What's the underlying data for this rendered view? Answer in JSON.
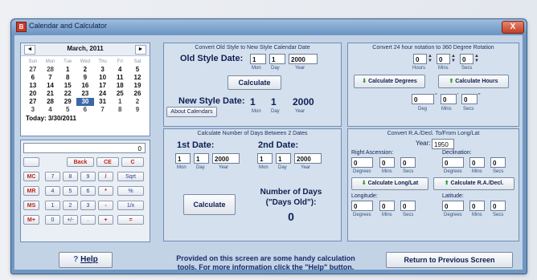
{
  "window": {
    "title": "Calendar and Calculator",
    "close_label": "X",
    "icon_label": "B"
  },
  "calendar": {
    "month_label": "March, 2011",
    "prev": "◄",
    "next": "►",
    "weekdays": [
      "Sun",
      "Mon",
      "Tue",
      "Wed",
      "Thu",
      "Fri",
      "Sat"
    ],
    "weeks": [
      [
        "27",
        "28",
        "1",
        "2",
        "3",
        "4",
        "5"
      ],
      [
        "6",
        "7",
        "8",
        "9",
        "10",
        "11",
        "12"
      ],
      [
        "13",
        "14",
        "15",
        "16",
        "17",
        "18",
        "19"
      ],
      [
        "20",
        "21",
        "22",
        "23",
        "24",
        "25",
        "26"
      ],
      [
        "27",
        "28",
        "29",
        "30",
        "31",
        "1",
        "2"
      ],
      [
        "3",
        "4",
        "5",
        "6",
        "7",
        "8",
        "9"
      ]
    ],
    "today_label": "Today: 3/30/2011"
  },
  "calculator": {
    "display": "0",
    "row1": [
      "Back",
      "CE",
      "C"
    ],
    "rows": [
      [
        "MC",
        "7",
        "8",
        "9",
        "/",
        "Sqrt"
      ],
      [
        "MR",
        "4",
        "5",
        "6",
        "*",
        "%"
      ],
      [
        "MS",
        "1",
        "2",
        "3",
        "-",
        "1/x"
      ],
      [
        "M+",
        "0",
        "+/-",
        ".",
        "+",
        "="
      ]
    ]
  },
  "old_style": {
    "title": "Convert Old Style to New Style Calendar Date",
    "label": "Old Style Date:",
    "month": "1",
    "day": "1",
    "year": "2000",
    "sub_mon": "Mon",
    "sub_day": "Day",
    "sub_year": "Year",
    "calculate": "Calculate",
    "result_label": "New Style Date:",
    "r_month": "1",
    "r_day": "1",
    "r_year": "2000",
    "about": "About Calendars"
  },
  "days_between": {
    "title": "Calculate Number of Days Between 2 Dates",
    "first_label": "1st Date:",
    "second_label": "2nd Date:",
    "d1_month": "1",
    "d1_day": "1",
    "d1_year": "2000",
    "d2_month": "1",
    "d2_day": "1",
    "d2_year": "2000",
    "sub_mon": "Mon",
    "sub_day": "Day",
    "sub_year": "Year",
    "calculate": "Calculate",
    "result_label_1": "Number of Days",
    "result_label_2": "(\"Days Old\"):",
    "result_value": "0"
  },
  "rotation": {
    "title": "Convert 24 hour notation to 360 Degree Rotation",
    "hours": "0",
    "mins": "0",
    "secs": "0",
    "sub_hours": "Hours",
    "sub_mins": "Mins",
    "sub_secs": "Secs",
    "calc_degrees": "Calculate Degrees",
    "calc_hours": "Calculate Hours",
    "deg": "0",
    "min": "0",
    "sec": "0",
    "sub_deg": "Deg",
    "sub_min": "Mins",
    "sub_sec": "Secs"
  },
  "radec": {
    "title": "Convert R.A./Decl. To/From Long/Lat",
    "year_label": "Year:",
    "year": "1950",
    "ra_label": "Right Ascension:",
    "decl_label": "Declination:",
    "long_label": "Longitude:",
    "lat_label": "Latitude:",
    "zero": "0",
    "sub_degrees": "Degrees",
    "sub_mins": "Mins",
    "sub_secs": "Secs",
    "calc_longlat": "Calculate Long/Lat",
    "calc_radec": "Calculate R.A./Decl."
  },
  "footer": {
    "help": "Help",
    "help_icon": "?",
    "info_1": "Provided on this screen are some handy calculation",
    "info_2": "tools. For more information click the \"Help\" button.",
    "return": "Return to Previous Screen"
  }
}
